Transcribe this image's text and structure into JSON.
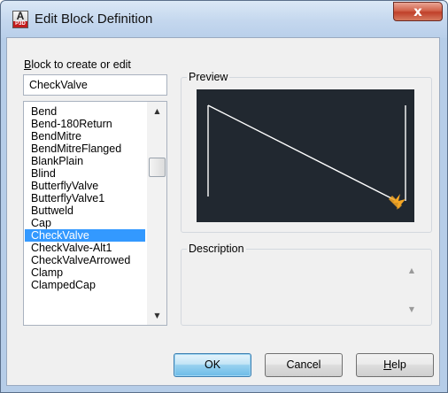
{
  "window": {
    "title": "Edit Block Definition",
    "icon_text": "A",
    "icon_subtext": "P3D",
    "close_glyph": "x"
  },
  "block": {
    "label_mnemonic": "B",
    "label_rest": "lock to create or edit",
    "name_value": "CheckValve",
    "items": [
      "Bend",
      "Bend-180Return",
      "BendMitre",
      "BendMitreFlanged",
      "BlankPlain",
      "Blind",
      "ButterflyValve",
      "ButterflyValve1",
      "Buttweld",
      "Cap",
      "CheckValve",
      "CheckValve-Alt1",
      "CheckValveArrowed",
      "Clamp",
      "ClampedCap"
    ],
    "selected_item": "CheckValve"
  },
  "preview": {
    "label": "Preview",
    "background": "#212830",
    "line_color": "#ffffff",
    "marker_color": "#f5a623"
  },
  "description": {
    "label": "Description",
    "text": ""
  },
  "buttons": {
    "ok_label": "OK",
    "cancel_label": "Cancel",
    "help_mnemonic": "H",
    "help_rest": "elp"
  },
  "colors": {
    "selection": "#3399ff",
    "close_button": "#c0402a"
  }
}
